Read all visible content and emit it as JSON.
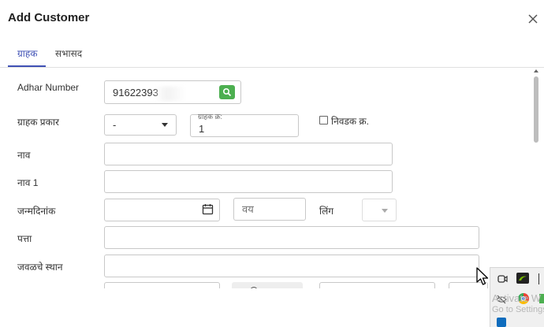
{
  "dialog": {
    "title": "Add Customer"
  },
  "tabs": [
    {
      "label": "ग्राहक",
      "active": true
    },
    {
      "label": "सभासद",
      "active": false
    }
  ],
  "form": {
    "adhar": {
      "label": "Adhar Number",
      "value": "91622393"
    },
    "customer_type": {
      "label": "ग्राहक प्रकार",
      "value": "-"
    },
    "customer_no": {
      "float_label": "ग्राहक क्र:",
      "value": "1"
    },
    "select_no": {
      "label": "निवडक क्र.",
      "checked": false
    },
    "name": {
      "label": "नाव",
      "value": ""
    },
    "name1": {
      "label": "नाव 1",
      "value": ""
    },
    "dob": {
      "label": "जन्मदिनांक",
      "value": ""
    },
    "age": {
      "placeholder": "वय"
    },
    "gender": {
      "label": "लिंग",
      "value": ""
    },
    "address": {
      "label": "पत्ता",
      "value": ""
    },
    "nearby_place": {
      "label": "जवळचे स्थान",
      "value": ""
    }
  },
  "overlay": {
    "watermark_line1": "Activate W",
    "watermark_line2": "Go to Settings"
  },
  "colors": {
    "accent": "#3f51b5",
    "search_button": "#4caf50"
  }
}
